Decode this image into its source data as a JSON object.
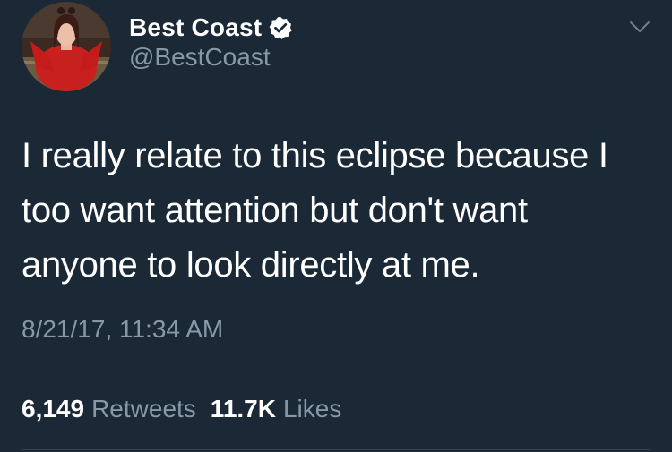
{
  "author": {
    "display_name": "Best Coast",
    "handle": "@BestCoast",
    "verified": true,
    "avatar_icon": "profile-photo"
  },
  "tweet": {
    "lines": [
      "I really relate to this eclipse because I",
      "too want attention but don't want",
      "anyone to look directly at me."
    ],
    "timestamp": "8/21/17, 11:34 AM"
  },
  "stats": {
    "retweets_count": "6,149",
    "retweets_label": "Retweets",
    "likes_count": "11.7K",
    "likes_label": "Likes"
  },
  "colors": {
    "background": "#1b2836",
    "text": "#ffffff",
    "secondary_text": "#8899a6",
    "divider": "#38444d"
  },
  "icons": {
    "verified": "verified-badge-icon",
    "menu": "chevron-down-icon"
  }
}
